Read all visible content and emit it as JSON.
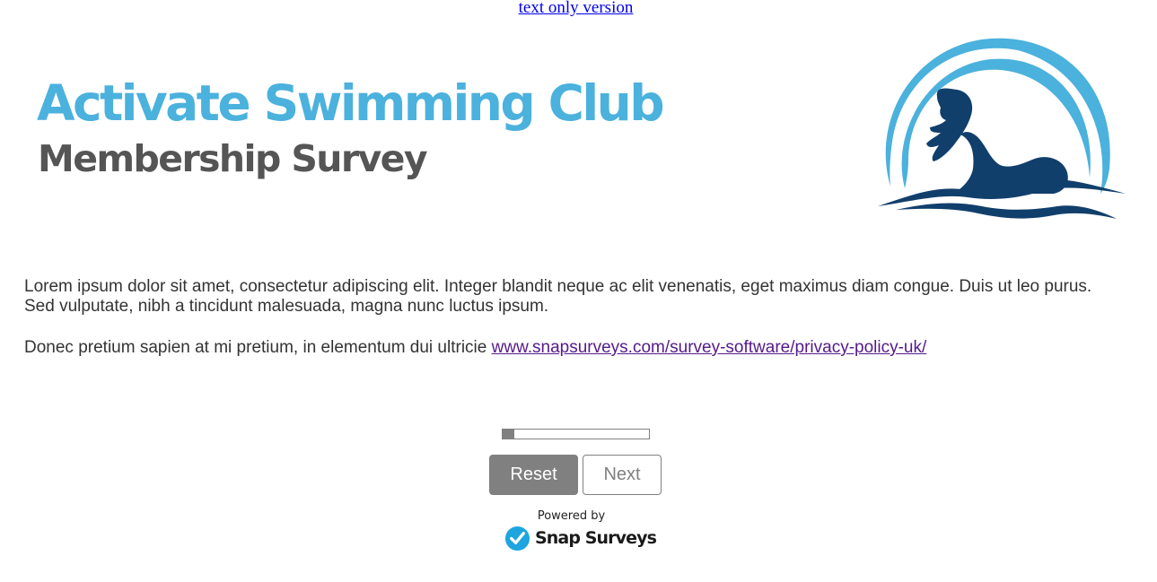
{
  "top_link": {
    "label": "text only version"
  },
  "header": {
    "title": "Activate Swimming Club",
    "subtitle": "Membership Survey",
    "logo": "swimmer-logo"
  },
  "intro": {
    "paragraph1": "Lorem ipsum dolor sit amet, consectetur adipiscing elit. Integer blandit neque ac elit venenatis, eget maximus diam congue. Duis ut leo purus. Sed vulputate, nibh a tincidunt malesuada, magna nunc luctus ipsum.",
    "paragraph2": "Donec pretium sapien at mi pretium, in elementum dui ultricie",
    "privacy_link": "www.snapsurveys.com/survey-software/privacy-policy-uk/"
  },
  "progress": {
    "fraction": 0.08
  },
  "buttons": {
    "reset_label": "Reset",
    "next_label": "Next"
  },
  "footer": {
    "powered_by": "Powered by",
    "brand": "Snap Surveys",
    "brand_icon": "check-circle-icon"
  },
  "colors": {
    "title": "#4bb1dd",
    "subtitle": "#555555",
    "logo_light": "#4bb1dd",
    "logo_dark": "#113f6c",
    "button_gray": "#808080",
    "snap_check": "#1ea5e0"
  }
}
